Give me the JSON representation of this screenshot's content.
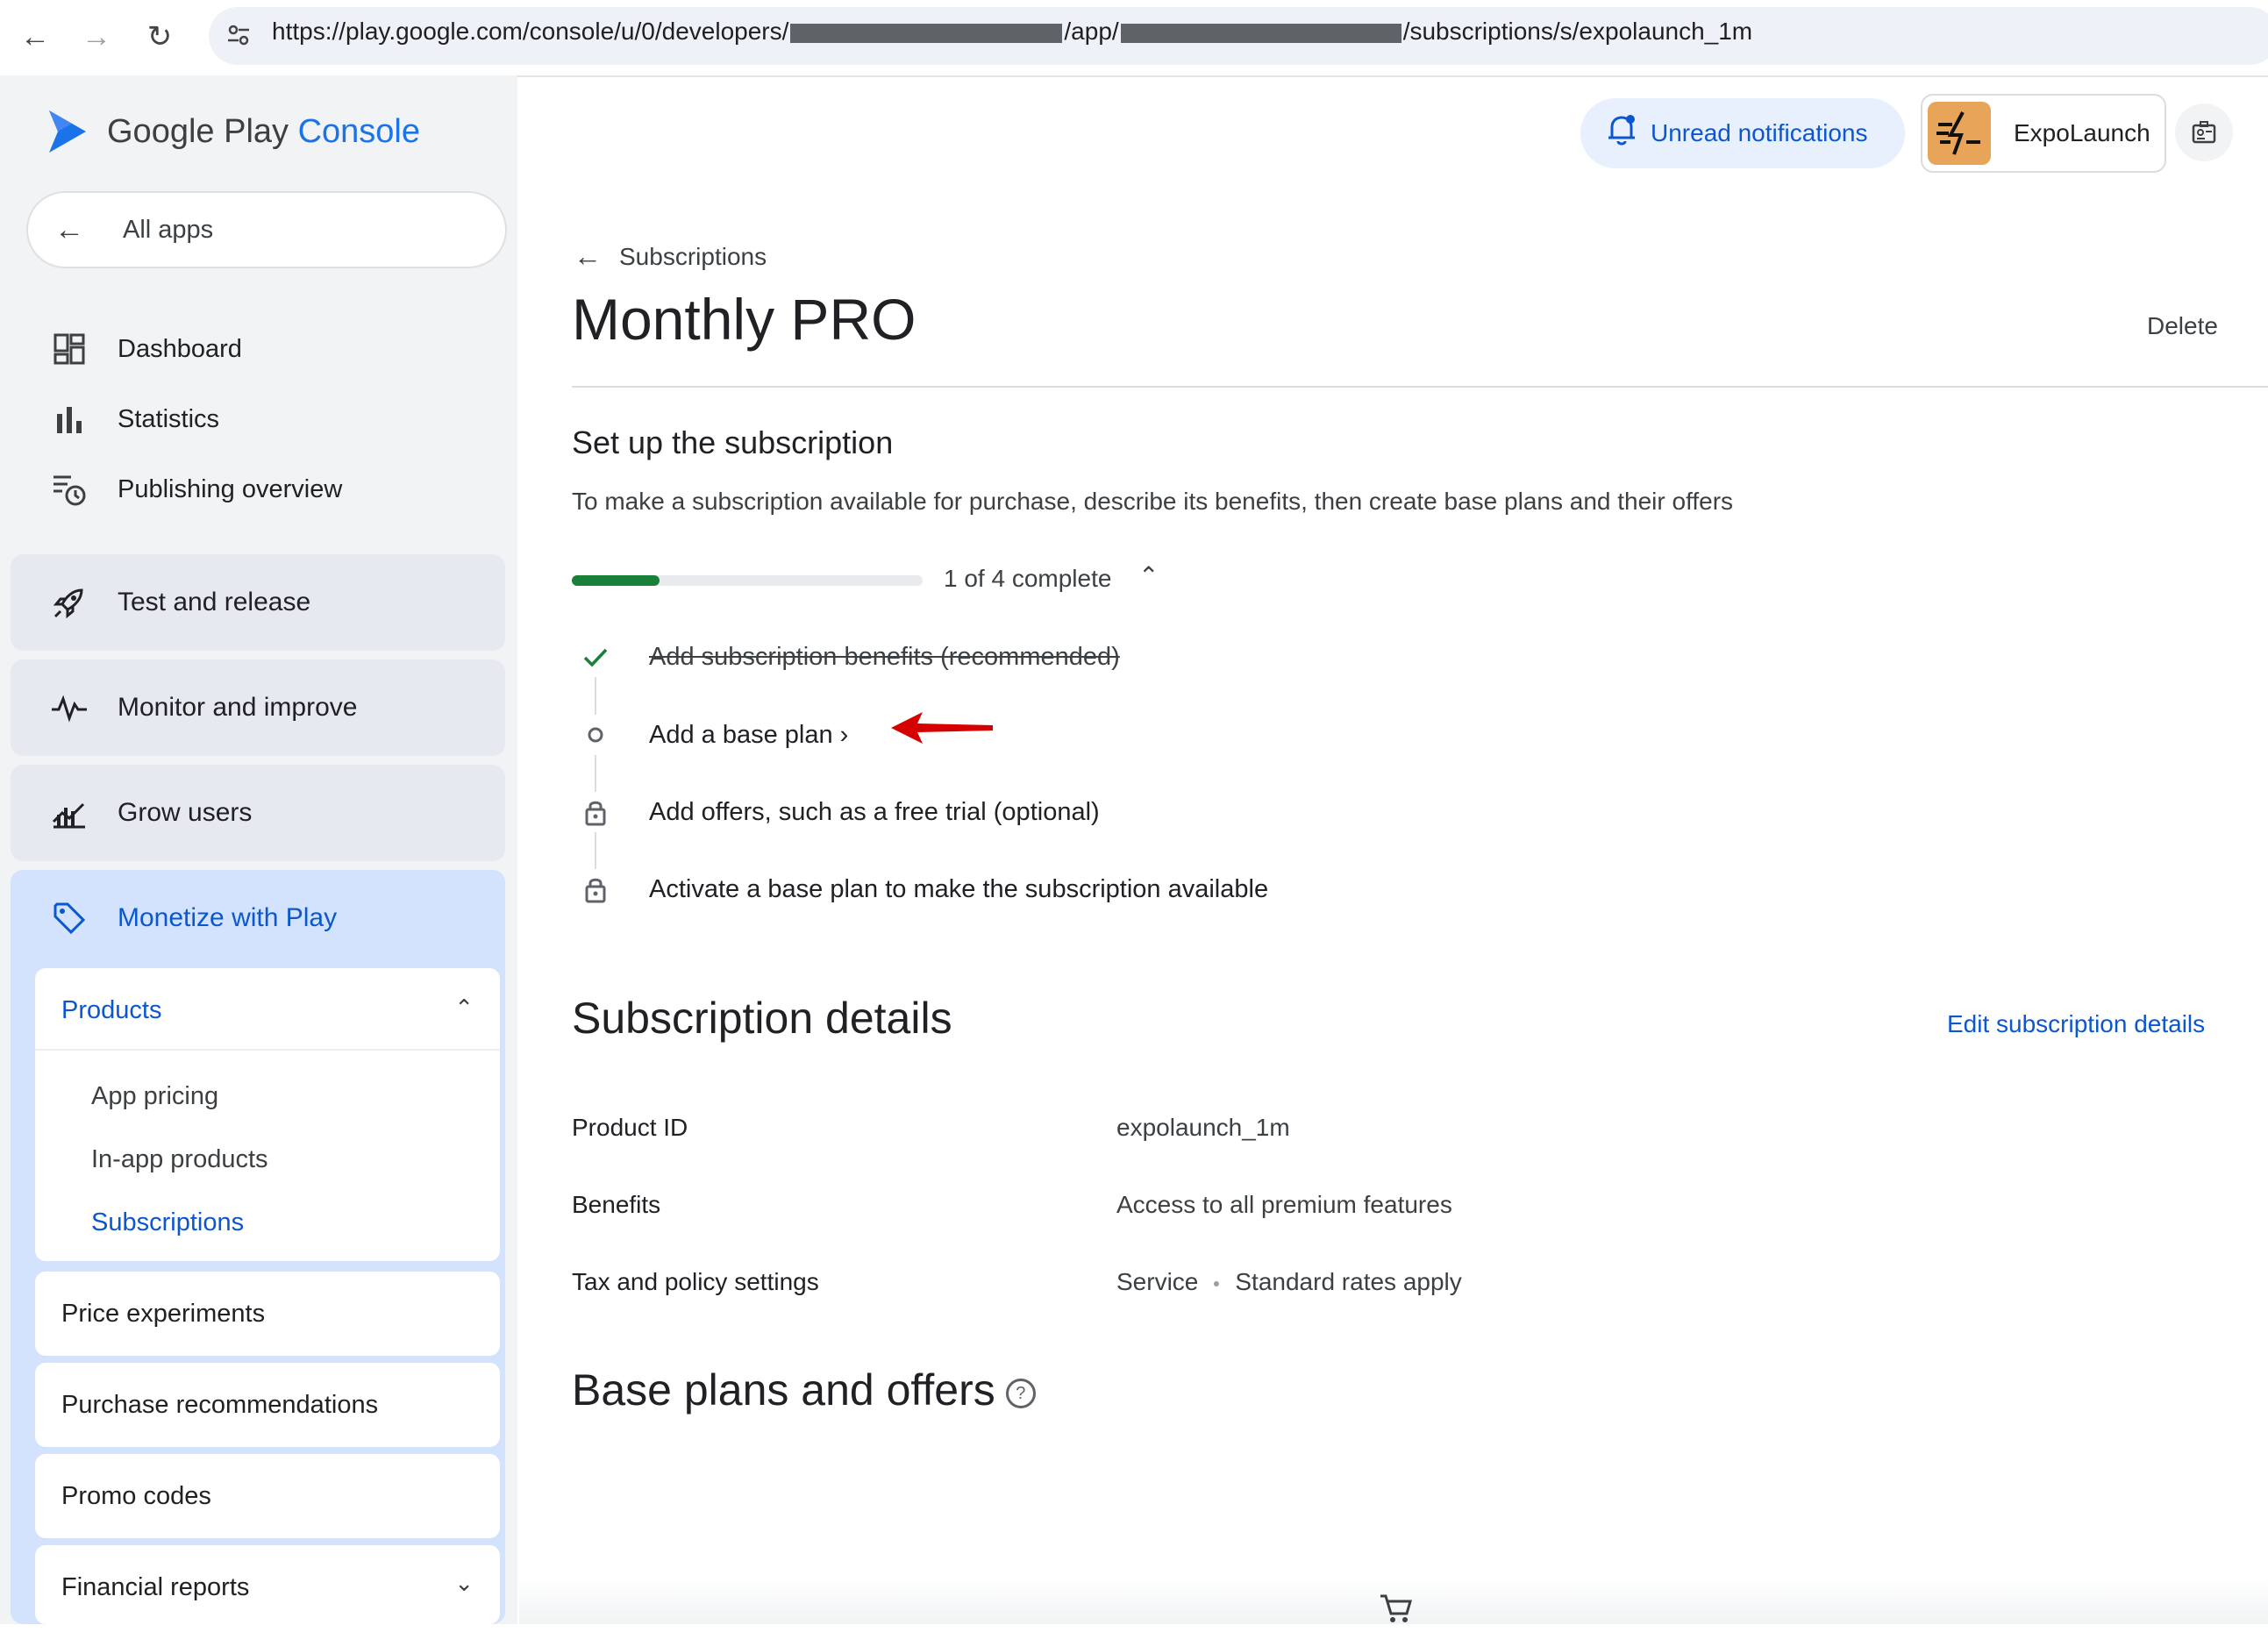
{
  "browser": {
    "url_prefix": "https://play.google.com/console/u/0/developers/",
    "url_mid": "/app/",
    "url_suffix": "/subscriptions/s/expolaunch_1m"
  },
  "brand": {
    "google_play": "Google Play",
    "console": "Console"
  },
  "header": {
    "notifications_label": "Unread notifications",
    "developer_name": "ExpoLaunch",
    "accent": "#0b57d0"
  },
  "sidebar": {
    "all_apps": "All apps",
    "items": [
      {
        "label": "Dashboard",
        "icon": "dashboard-icon"
      },
      {
        "label": "Statistics",
        "icon": "bar-chart-icon"
      },
      {
        "label": "Publishing overview",
        "icon": "publishing-icon"
      }
    ],
    "groups": [
      {
        "label": "Test and release",
        "icon": "rocket-icon"
      },
      {
        "label": "Monitor and improve",
        "icon": "pulse-icon"
      },
      {
        "label": "Grow users",
        "icon": "growth-icon"
      }
    ],
    "monetize": {
      "label": "Monetize with Play",
      "products_label": "Products",
      "product_items": [
        "App pricing",
        "In-app products",
        "Subscriptions"
      ],
      "active_item": "Subscriptions",
      "other_cards": [
        "Price experiments",
        "Purchase recommendations",
        "Promo codes",
        "Financial reports"
      ]
    }
  },
  "main": {
    "back_label": "Subscriptions",
    "title": "Monthly PRO",
    "delete_label": "Delete",
    "setup": {
      "heading": "Set up the subscription",
      "description": "To make a subscription available for purchase, describe its benefits, then create base plans and their offers",
      "progress": 0.25,
      "progress_label": "1 of 4 complete",
      "progress_color": "#188038",
      "steps": [
        {
          "label": "Add subscription benefits (recommended)",
          "state": "done"
        },
        {
          "label": "Add a base plan",
          "state": "current"
        },
        {
          "label": "Add offers, such as a free trial (optional)",
          "state": "locked"
        },
        {
          "label": "Activate a base plan to make the subscription available",
          "state": "locked"
        }
      ]
    },
    "details": {
      "heading": "Subscription details",
      "edit_label": "Edit subscription details",
      "rows": [
        {
          "label": "Product ID",
          "value": "expolaunch_1m"
        },
        {
          "label": "Benefits",
          "value": "Access to all premium features"
        },
        {
          "label": "Tax and policy settings",
          "value_a": "Service",
          "value_b": "Standard rates apply"
        }
      ]
    },
    "base_plans_heading": "Base plans and offers",
    "annotation_arrow_color": "#d50000"
  }
}
